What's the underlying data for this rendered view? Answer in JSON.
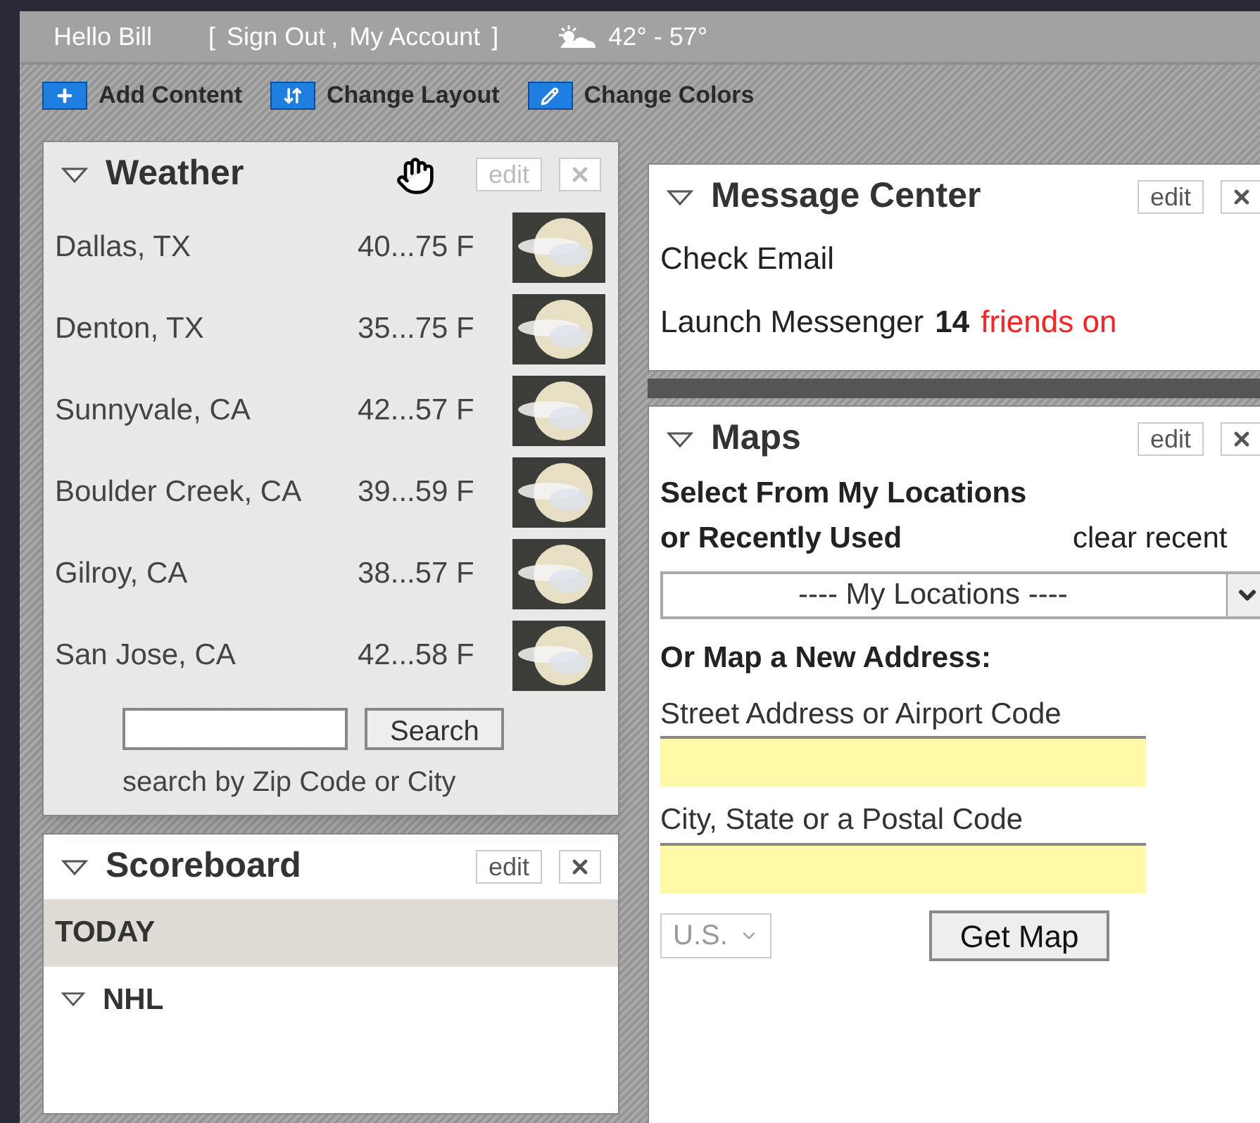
{
  "top_bar": {
    "greeting": "Hello Bill",
    "bracket_open": "[",
    "account_links": [
      {
        "label": "Sign Out"
      },
      {
        "label": "My Account"
      }
    ],
    "separator": ",",
    "bracket_close": "]",
    "forecast": "42° - 57°"
  },
  "toolbar": [
    {
      "kind": "add",
      "label": "Add Content"
    },
    {
      "kind": "layout",
      "label": "Change Layout"
    },
    {
      "kind": "colors",
      "label": "Change Colors"
    }
  ],
  "weather": {
    "title": "Weather",
    "edit": "edit",
    "dragging": true,
    "rows": [
      {
        "city": "Dallas, TX",
        "temps": "40...75 F"
      },
      {
        "city": "Denton, TX",
        "temps": "35...75 F"
      },
      {
        "city": "Sunnyvale, CA",
        "temps": "42...57 F"
      },
      {
        "city": "Boulder Creek, CA",
        "temps": "39...59 F"
      },
      {
        "city": "Gilroy, CA",
        "temps": "38...57 F"
      },
      {
        "city": "San Jose, CA",
        "temps": "42...58 F"
      }
    ],
    "search_button": "Search",
    "search_hint": "search by Zip Code or City"
  },
  "scoreboard": {
    "title": "Scoreboard",
    "edit": "edit",
    "day": "TODAY",
    "leagues": [
      {
        "name": "NHL"
      }
    ]
  },
  "message_center": {
    "title": "Message Center",
    "edit": "edit",
    "check_email": "Check Email",
    "messenger": "Launch Messenger",
    "friends_count": "14",
    "friends_status": "friends on"
  },
  "maps": {
    "title": "Maps",
    "edit": "edit",
    "select_label": "Select From My Locations or Recently Used",
    "clear_link": "clear recent",
    "locations_select": "---- My Locations ----",
    "new_address_heading": "Or Map a New Address:",
    "fields": [
      {
        "label": "Street Address or Airport Code"
      },
      {
        "label": "City, State or a Postal Code"
      }
    ],
    "country": "U.S.",
    "button": "Get Map"
  }
}
